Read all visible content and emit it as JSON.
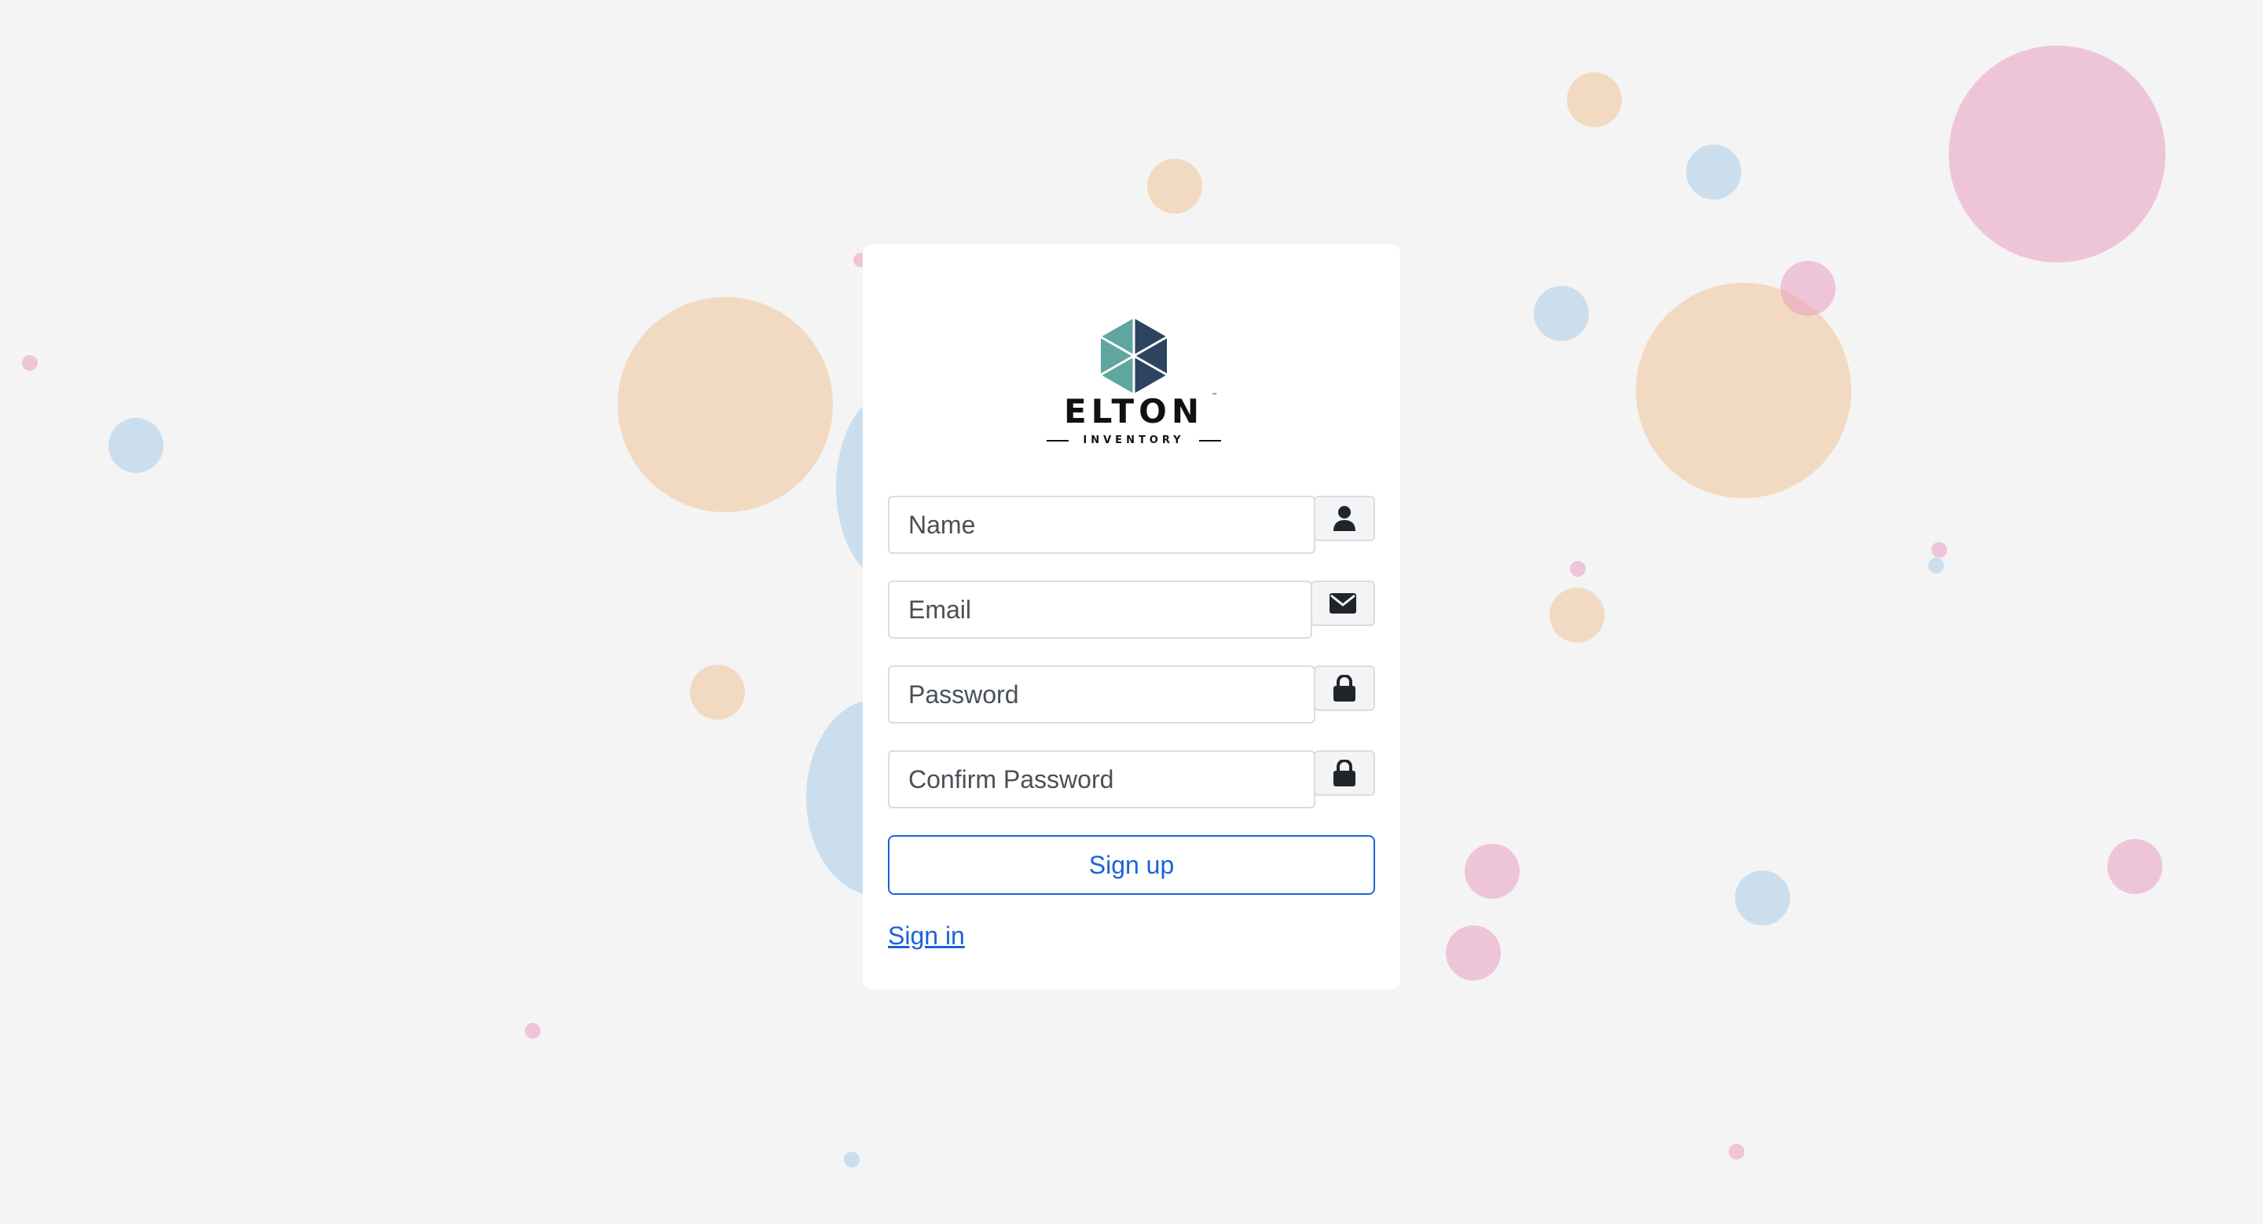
{
  "app": {
    "brand_name": "ELTON",
    "brand_tagline": "INVENTORY",
    "brand_trademark": "™"
  },
  "form": {
    "fields": [
      {
        "placeholder": "Name",
        "value": "",
        "icon": "user-icon"
      },
      {
        "placeholder": "Email",
        "value": "",
        "icon": "envelope-icon"
      },
      {
        "placeholder": "Password",
        "value": "",
        "icon": "lock-icon"
      },
      {
        "placeholder": "Confirm Password",
        "value": "",
        "icon": "lock-icon"
      }
    ],
    "submit_label": "Sign up",
    "alt_link_label": "Sign in"
  },
  "colors": {
    "page_background": "#f4f4f4",
    "card_background": "#ffffff",
    "accent": "#1d62d8",
    "logo_teal": "#5fa6a0",
    "logo_navy": "#2c4460",
    "bubble_peach": "#f1c499",
    "bubble_blue": "#a0c8e8",
    "bubble_pink": "#e896bc"
  }
}
